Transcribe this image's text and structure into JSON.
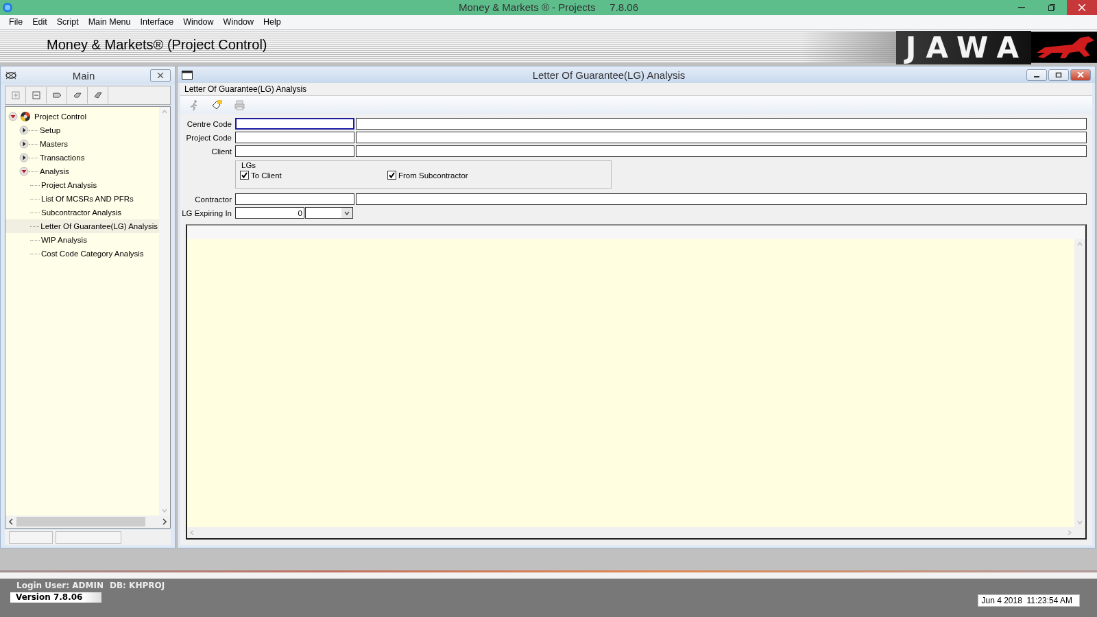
{
  "window": {
    "title": "Money & Markets ® - Projects",
    "version": "7.8.06"
  },
  "menu": [
    "File",
    "Edit",
    "Script",
    "Main Menu",
    "Interface",
    "Window",
    "Window",
    "Help"
  ],
  "banner": {
    "title": "Money & Markets® (Project Control)",
    "logo": "JAWA"
  },
  "nav_panel": {
    "title": "Main",
    "tree": [
      {
        "label": "Project Control",
        "expanded": true,
        "selected": false,
        "children": [
          {
            "label": "Setup",
            "expanded": false,
            "selected": false
          },
          {
            "label": "Masters",
            "expanded": false,
            "selected": false
          },
          {
            "label": "Transactions",
            "expanded": false,
            "selected": false
          },
          {
            "label": "Analysis",
            "expanded": true,
            "selected": false,
            "children": [
              {
                "label": "Project Analysis",
                "selected": false
              },
              {
                "label": "List Of MCSRs AND PFRs",
                "selected": false
              },
              {
                "label": "Subcontractor Analysis",
                "selected": false
              },
              {
                "label": "Letter Of Guarantee(LG) Analysis",
                "selected": true
              },
              {
                "label": "WIP Analysis",
                "selected": false
              },
              {
                "label": "Cost Code Category Analysis",
                "selected": false
              }
            ]
          }
        ]
      }
    ]
  },
  "form_window": {
    "title": "Letter Of Guarantee(LG) Analysis",
    "caption": "Letter Of Guarantee(LG) Analysis",
    "rows": [
      {
        "kind": "lookup",
        "label": "Centre Code",
        "focused": true
      },
      {
        "kind": "lookup",
        "label": "Project Code",
        "focused": false
      },
      {
        "kind": "lookup",
        "label": "Client",
        "focused": false
      },
      {
        "kind": "group",
        "label": "LGs",
        "options": [
          {
            "label": "To Client",
            "checked": true
          },
          {
            "label": "From Subcontractor",
            "checked": true
          }
        ]
      },
      {
        "kind": "lookup",
        "label": "Contractor",
        "focused": false
      },
      {
        "kind": "number-select",
        "label": "LG Expiring In",
        "value": "0",
        "focused": false
      }
    ]
  },
  "status_bar": {
    "user": "Login User: ADMIN",
    "db": "DB: KHPROJ",
    "version": "Version 7.8.06",
    "datetime": "Jun 4 2018  11:23:54 AM"
  }
}
